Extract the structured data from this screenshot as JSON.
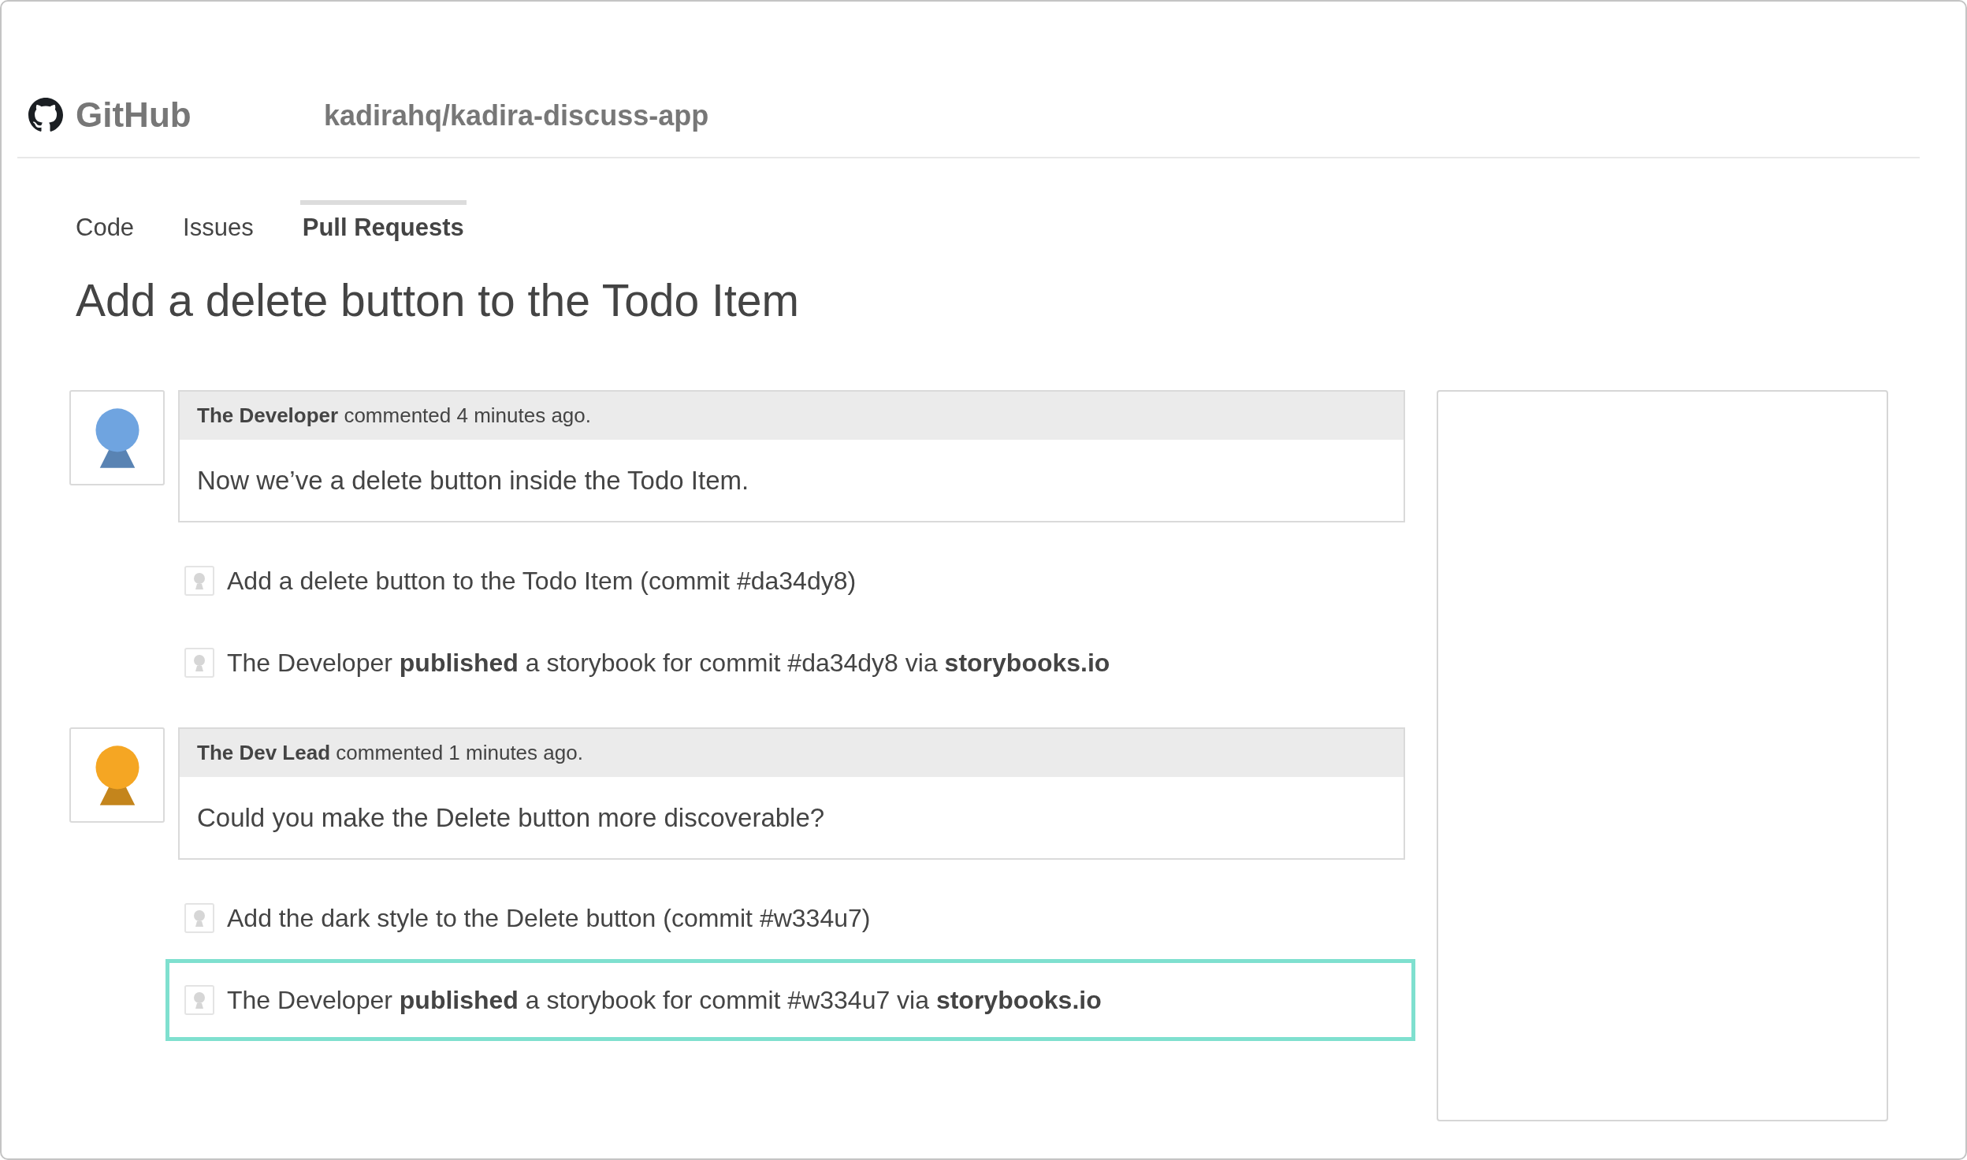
{
  "header": {
    "brand": "GitHub",
    "repository": "kadirahq/kadira-discuss-app"
  },
  "tabs": [
    {
      "label": "Code",
      "selected": false
    },
    {
      "label": "Issues",
      "selected": false
    },
    {
      "label": "Pull Requests",
      "selected": true
    }
  ],
  "title": "Add a delete button to the Todo Item",
  "timeline": [
    {
      "kind": "comment",
      "color": "#6fa4e0",
      "byline": "**The Developer** commented 4 minutes ago.",
      "body": "Now we’ve a delete button inside the Todo Item.",
      "highlighted": false
    },
    {
      "kind": "event",
      "text": "Add a delete button to the Todo Item (commit #da34dy8)",
      "highlighted": false
    },
    {
      "kind": "event",
      "text": "The Developer **published** a storybook for commit #da34dy8 via **storybooks.io**",
      "highlighted": false
    },
    {
      "kind": "comment",
      "color": "#f5a623",
      "byline": "**The Dev Lead** commented 1 minutes ago.",
      "body": "Could you make the Delete button more discoverable?",
      "highlighted": false
    },
    {
      "kind": "event",
      "text": "Add the dark style to the Delete button (commit #w334u7)",
      "highlighted": false
    },
    {
      "kind": "event",
      "text": "The Developer **published** a storybook for commit #w334u7 via **storybooks.io**",
      "highlighted": true
    }
  ]
}
